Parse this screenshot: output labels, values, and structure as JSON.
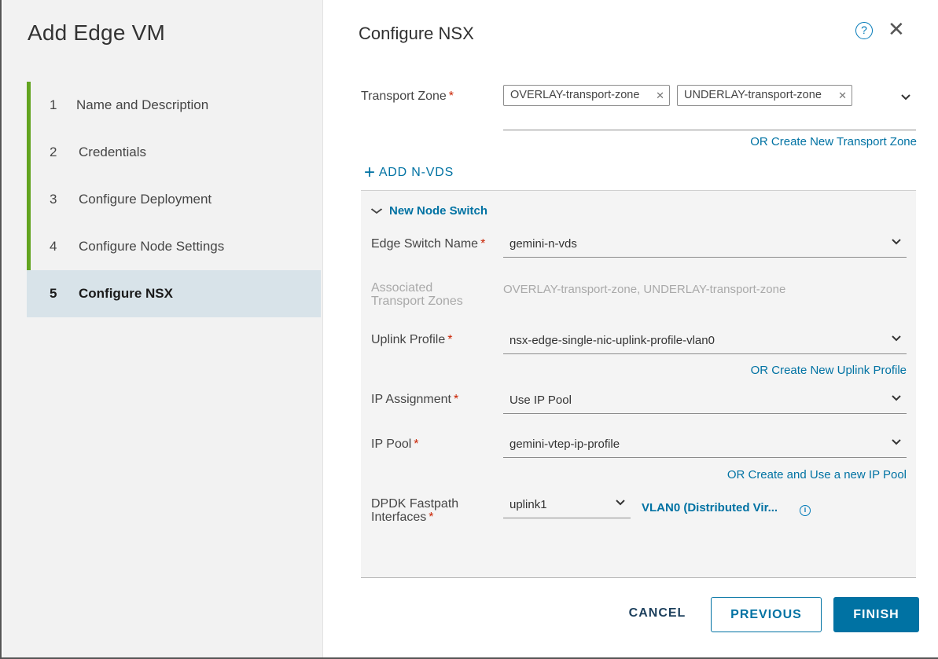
{
  "nav": {
    "title": "Add Edge VM",
    "steps": [
      {
        "num": "1",
        "label": "Name and Description"
      },
      {
        "num": "2",
        "label": "Credentials"
      },
      {
        "num": "3",
        "label": "Configure Deployment"
      },
      {
        "num": "4",
        "label": "Configure Node Settings"
      },
      {
        "num": "5",
        "label": "Configure NSX"
      }
    ]
  },
  "main": {
    "title": "Configure NSX",
    "transport_zone": {
      "label": "Transport Zone",
      "chips": [
        "OVERLAY-transport-zone",
        "UNDERLAY-transport-zone"
      ],
      "create_link": "OR Create New Transport Zone"
    },
    "add_nvds": "ADD N-VDS",
    "node_switch": {
      "header": "New Node Switch",
      "edge_switch_name": {
        "label": "Edge Switch Name",
        "value": "gemini-n-vds"
      },
      "assoc_tz": {
        "label_line1": "Associated",
        "label_line2": "Transport Zones",
        "value": "OVERLAY-transport-zone, UNDERLAY-transport-zone"
      },
      "uplink_profile": {
        "label": "Uplink Profile",
        "value": "nsx-edge-single-nic-uplink-profile-vlan0",
        "create_link": "OR Create New Uplink Profile"
      },
      "ip_assignment": {
        "label": "IP Assignment",
        "value": "Use IP Pool"
      },
      "ip_pool": {
        "label": "IP Pool",
        "value": "gemini-vtep-ip-profile",
        "create_link": "OR Create and Use a new IP Pool"
      },
      "dpdk": {
        "label_line1": "DPDK Fastpath",
        "label_line2": "Interfaces",
        "uplink": "uplink1",
        "mapping": "VLAN0 (Distributed Vir..."
      }
    },
    "buttons": {
      "cancel": "CANCEL",
      "previous": "PREVIOUS",
      "finish": "FINISH"
    },
    "required_mark": "*"
  },
  "colors": {
    "accent": "#0072a3",
    "step_done": "#62a420",
    "active_step_bg": "#d8e3e9",
    "required": "#c92100"
  }
}
